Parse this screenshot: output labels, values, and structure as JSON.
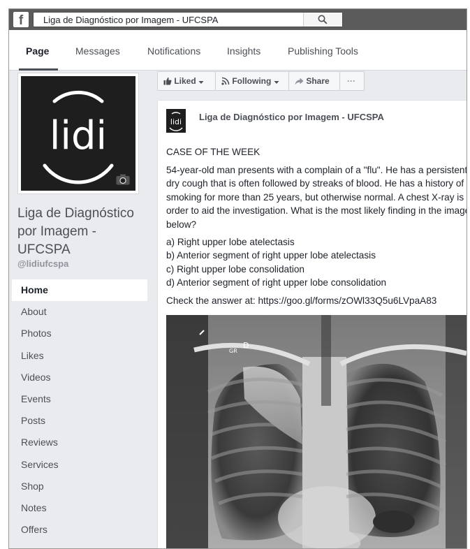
{
  "topbar": {
    "logo_letter": "f",
    "search_value": "Liga de Diagnóstico por Imagem - UFCSPA"
  },
  "tabs": [
    "Page",
    "Messages",
    "Notifications",
    "Insights",
    "Publishing Tools"
  ],
  "profile": {
    "logo_text": "lidi",
    "name": "Liga de Diagnóstico por Imagem - UFCSPA",
    "handle": "@lidiufcspa"
  },
  "nav": {
    "items": [
      "Home",
      "About",
      "Photos",
      "Likes",
      "Videos",
      "Events",
      "Posts",
      "Reviews",
      "Services",
      "Shop",
      "Notes",
      "Offers"
    ]
  },
  "actions": {
    "liked": "Liked",
    "following": "Following",
    "share": "Share",
    "more": "···"
  },
  "post": {
    "avatar_text": "lidi",
    "author": "Liga de Diagnóstico por Imagem - UFCSPA",
    "heading": "CASE OF THE WEEK",
    "body": "54-year-old man presents with a complain of a \"flu\". He has a persistent dry cough that is often followed by streaks of blood. He has a history of smoking for more than 25 years, but otherwise normal. A chest X-ray is order to aid the investigation. What is the most likely finding in the image below?",
    "options": [
      "a) Right upper lobe atelectasis",
      "b) Anterior segment of right upper lobe atelectasis",
      "c) Right upper lobe consolidation",
      "d) Anterior segment of right upper lobe consolidation"
    ],
    "answer": "Check the answer at: https://goo.gl/forms/zOWl33Q5u6LVpaA83",
    "xray_labels": {
      "marker": "GR",
      "side": "D"
    }
  }
}
